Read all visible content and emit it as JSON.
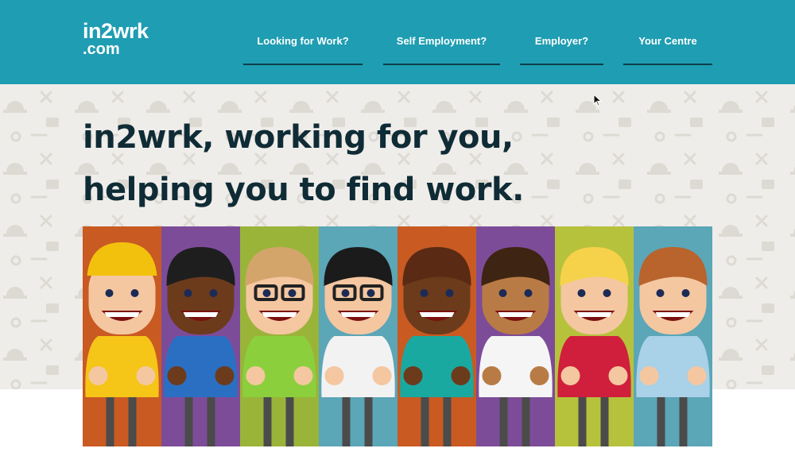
{
  "header": {
    "logo_line1": "in2wrk",
    "logo_line2": ".com",
    "nav": [
      {
        "label": "Looking for Work?"
      },
      {
        "label": "Self Employment?"
      },
      {
        "label": "Employer?"
      },
      {
        "label": "Your Centre"
      }
    ]
  },
  "hero": {
    "headline_line1": "in2wrk, working for you,",
    "headline_line2": "helping you to find work."
  },
  "colors": {
    "header_bg": "#1f9db2",
    "headline_text": "#0f2c36",
    "hero_bg": "#efedea",
    "stripes": [
      "#c95a22",
      "#7d4c99",
      "#9ab43a",
      "#5ba6b7",
      "#c95a22",
      "#7d4c99",
      "#b7c23c",
      "#5ba6b7"
    ]
  },
  "illustration": {
    "characters": [
      {
        "name": "construction-worker",
        "skin": "#f4c7a1",
        "hair": "#f2c10e",
        "top": "#f5c518",
        "hard_hat": true,
        "glasses": false
      },
      {
        "name": "business-man",
        "skin": "#6b3b1c",
        "hair": "#1e1e1e",
        "top": "#2b6fc2",
        "hard_hat": false,
        "glasses": false
      },
      {
        "name": "glasses-man",
        "skin": "#f4c7a1",
        "hair": "#d3a56b",
        "top": "#8ccf3c",
        "hard_hat": false,
        "glasses": true
      },
      {
        "name": "office-worker",
        "skin": "#f4c7a1",
        "hair": "#1b1b1b",
        "top": "#f2f2f2",
        "hard_hat": false,
        "glasses": true
      },
      {
        "name": "dark-woman",
        "skin": "#6b3b1c",
        "hair": "#5a2a14",
        "top": "#1aa9a0",
        "hard_hat": false,
        "glasses": false
      },
      {
        "name": "waitress",
        "skin": "#b97b45",
        "hair": "#3e2412",
        "top": "#f5f5f5",
        "hard_hat": false,
        "glasses": false
      },
      {
        "name": "blonde-woman",
        "skin": "#f4c7a1",
        "hair": "#f6d24a",
        "top": "#d01f3c",
        "hard_hat": false,
        "glasses": false
      },
      {
        "name": "call-centre-man",
        "skin": "#f4c7a1",
        "hair": "#b9632d",
        "top": "#a9d1e8",
        "hard_hat": false,
        "glasses": false
      }
    ]
  }
}
